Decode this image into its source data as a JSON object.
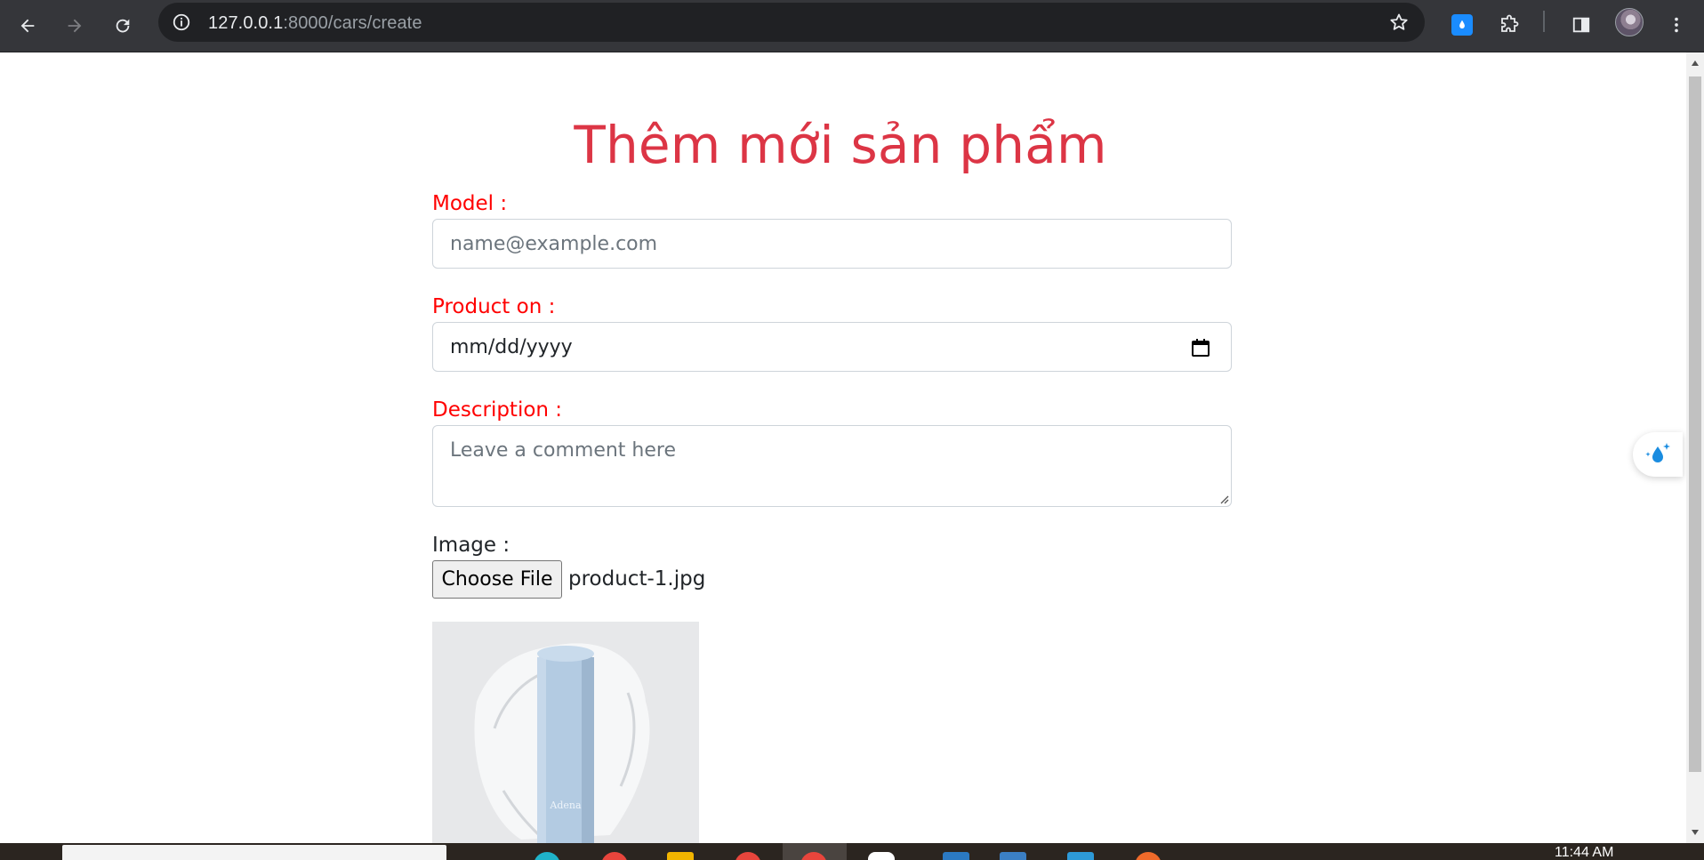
{
  "browser": {
    "url_host": "127.0.0.1",
    "url_path": ":8000/cars/create"
  },
  "page": {
    "title": "Thêm mới sản phẩm",
    "form": {
      "model_label": "Model :",
      "model_placeholder": "name@example.com",
      "product_on_label": "Product on :",
      "product_on_value": "mm/dd/yyyy",
      "description_label": "Description :",
      "description_placeholder": "Leave a comment here",
      "image_label": "Image :",
      "choose_file_label": "Choose File",
      "file_name": "product-1.jpg",
      "preview_brand": "Adena"
    }
  },
  "taskbar": {
    "clock": "11:44 AM"
  }
}
